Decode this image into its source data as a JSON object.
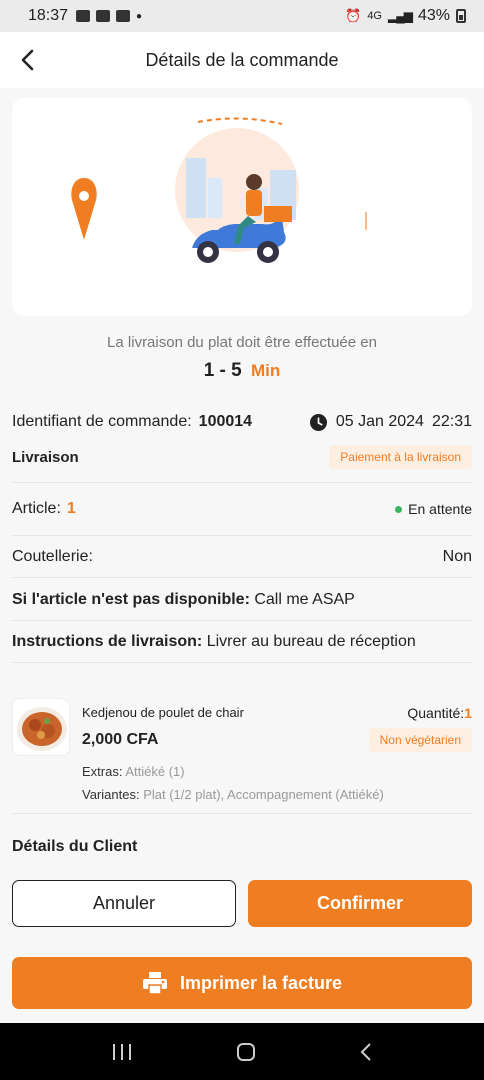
{
  "status_bar": {
    "time": "18:37",
    "battery": "43%",
    "network": "4G"
  },
  "app_bar": {
    "title": "Détails de la commande"
  },
  "delivery_eta": {
    "text": "La livraison du plat doit être effectuée en",
    "range": "1 - 5",
    "unit": "Min"
  },
  "order": {
    "id_label": "Identifiant de commande:",
    "id_value": "100014",
    "date": "05 Jan 2024",
    "time": "22:31",
    "type": "Livraison",
    "payment_badge": "Paiement à la livraison",
    "article_label": "Article:",
    "article_count": "1",
    "status": "En attente",
    "cutlery_label": "Coutellerie:",
    "cutlery_value": "Non",
    "unavailable_label": "Si l'article n'est pas disponible:",
    "unavailable_value": "Call me ASAP",
    "instructions_label": "Instructions de livraison:",
    "instructions_value": "Livrer au bureau de réception"
  },
  "item": {
    "name": "Kedjenou de poulet de chair",
    "price": "2,000 CFA",
    "quantity_label": "Quantité:",
    "quantity_value": "1",
    "veg_badge": "Non végétarien",
    "extras_label": "Extras:",
    "extras_value": "Attiéké (1)",
    "variants_label": "Variantes:",
    "variants_value": "Plat (1/2 plat), Accompagnement (Attiéké)"
  },
  "client_section_title": "Détails du Client",
  "buttons": {
    "cancel": "Annuler",
    "confirm": "Confirmer",
    "print": "Imprimer la facture"
  },
  "colors": {
    "accent": "#ef7d22",
    "status_green": "#3cb563"
  },
  "icons": {
    "back": "chevron-left-icon",
    "clock": "clock-icon",
    "printer": "printer-icon",
    "location_pin": "location-pin-icon"
  }
}
